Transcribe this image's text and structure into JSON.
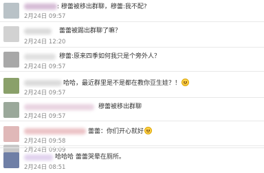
{
  "comments": [
    {
      "text": ": 穆蕾被移出群聊，穆蕾:我不配?",
      "time": "2月24日 09:57",
      "avatar_color": "#b9c2c7",
      "name_color": "#c9a7c9"
    },
    {
      "text": "蕾蕾被踢出群聊了嘛？",
      "time": "2月24日 12:20",
      "avatar_color": "#d2d2d2",
      "name_color": "#cfcfcf"
    },
    {
      "text": "穆蕾:原来四季如何我只是个旁外人？",
      "time": "2月24日 09:57",
      "avatar_color": "#a8a8a8",
      "name_color": "#d6d6d6"
    },
    {
      "text": "哈哈，最近群里是不是都在教你豆生娃？！",
      "time": "2月24日 09:57",
      "avatar_color": "#8aa06a",
      "name_color": "#d0d0d0",
      "emoji": true
    },
    {
      "text": "穆蕾被移出群聊",
      "time": "2月24日 09:57",
      "avatar_color": "#9aa89a",
      "name_color": "#e3c6d8"
    },
    {
      "text": "蕾蕾：你们开心就好",
      "time": "2月24日 09:58",
      "avatar_color": "#e0b8b8",
      "name_color": "#e6b0b4",
      "emoji": true
    },
    {
      "text": "：穆蕾：你们开心就好",
      "time": "2月24日 09:09",
      "avatar_color": "#c8c8c8",
      "name_color": "#d8d8d8"
    },
    {
      "text": "哈哈哈 蕾蕾哭晕在厕所。",
      "time": "2月24日 08:51",
      "avatar_color": "#6f7fa6",
      "name_color": "#d7c4e8"
    }
  ]
}
